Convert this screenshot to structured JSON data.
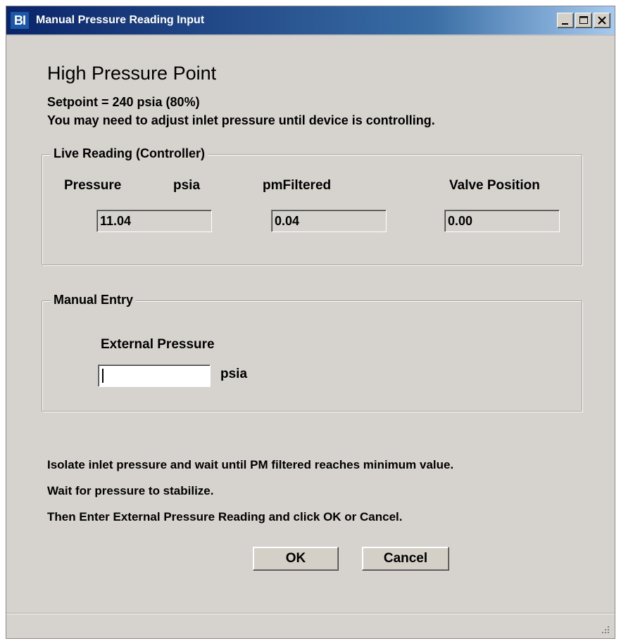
{
  "window": {
    "title": "Manual Pressure Reading Input",
    "icon_text": "BI",
    "controls": [
      "minimize-icon",
      "maximize-icon",
      "close-icon"
    ]
  },
  "heading": "High Pressure Point",
  "setpoint_text": "Setpoint = 240 psia (80%)",
  "adjust_text": "You may need to adjust inlet pressure until device is controlling.",
  "live_reading": {
    "legend": "Live Reading (Controller)",
    "pressure_label": "Pressure",
    "pressure_unit": "psia",
    "pm_label": "pmFiltered",
    "valve_label": "Valve Position",
    "pressure_value": "11.04",
    "pm_value": "0.04",
    "valve_value": "0.00"
  },
  "manual_entry": {
    "legend": "Manual Entry",
    "field_label": "External Pressure",
    "field_value": "",
    "unit": "psia"
  },
  "instructions": [
    "Isolate inlet pressure and wait until PM filtered reaches minimum value.",
    "Wait for pressure to stabilize.",
    "Then Enter External Pressure Reading and click OK or Cancel."
  ],
  "buttons": {
    "ok": "OK",
    "cancel": "Cancel"
  },
  "colors": {
    "dialog_bg": "#d6d3ce",
    "title_bar": "#0a246a"
  }
}
